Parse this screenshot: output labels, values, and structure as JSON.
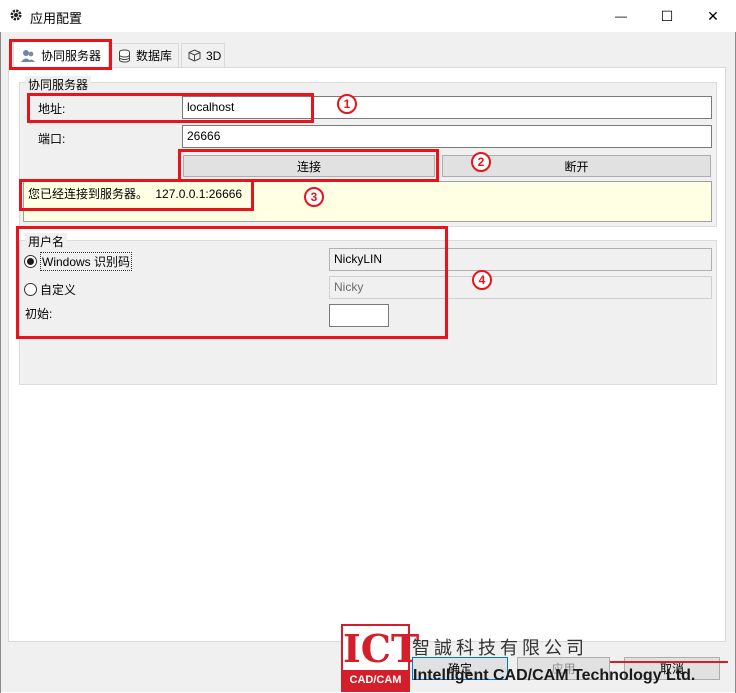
{
  "window": {
    "title": "应用配置",
    "minimize_glyph": "—",
    "maximize_glyph": "☐",
    "close_glyph": "✕"
  },
  "tabs": [
    {
      "label": "协同服务器",
      "icon": "users-icon"
    },
    {
      "label": "数据库",
      "icon": "database-icon"
    },
    {
      "label": "3D",
      "icon": "cube-icon"
    }
  ],
  "server": {
    "group_title": "协同服务器",
    "address_label": "地址:",
    "address_value": "localhost",
    "port_label": "端口:",
    "port_value": "26666",
    "connect_label": "连接",
    "disconnect_label": "断开",
    "status_prefix": "您已经连接到服务器。",
    "status_address": "127.0.0.1:26666"
  },
  "user": {
    "group_title": "用户名",
    "windows_option_label": "Windows 识别码",
    "windows_value": "NickyLIN",
    "custom_option_label": "自定义",
    "custom_value": "Nicky",
    "initial_label": "初始:",
    "initial_value": "",
    "selected_option": "windows"
  },
  "annotations": [
    "1",
    "2",
    "3",
    "4"
  ],
  "footer": {
    "ok_label": "确定",
    "apply_label": "应用",
    "cancel_label": "取消"
  },
  "watermark": {
    "logo_text": "ICT",
    "logo_sub": "CAD/CAM",
    "company_cn": "智誠科技有限公司",
    "company_en": "Intelligent CAD/CAM Technology Ltd."
  },
  "colors": {
    "annotation_red": "#e8141a",
    "status_background": "#ffffe4",
    "window_background": "#f0f0f0"
  }
}
